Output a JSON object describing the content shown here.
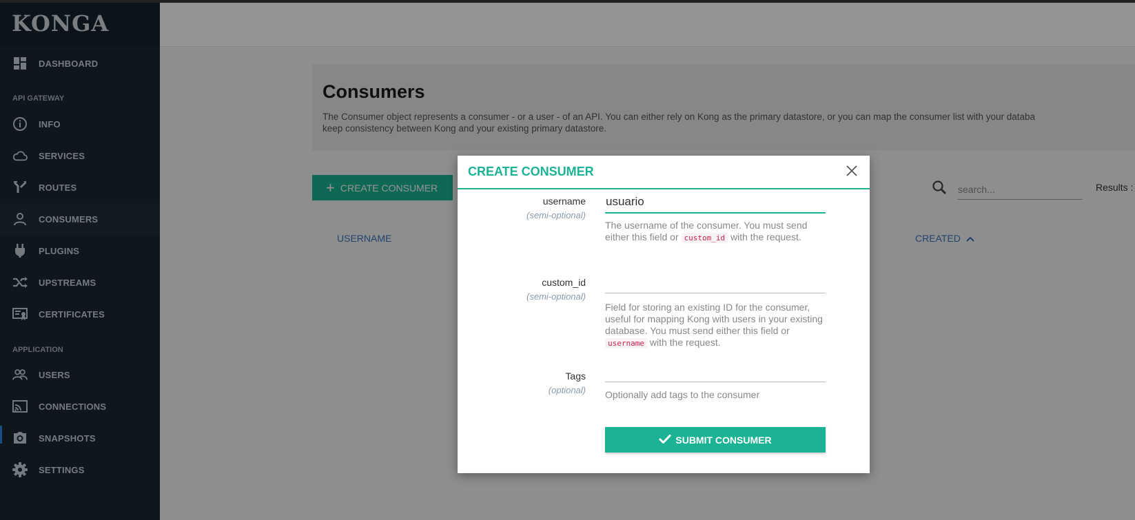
{
  "app": {
    "brand": "KONGA"
  },
  "sidebar": {
    "items": [
      {
        "label": "DASHBOARD",
        "icon": "dashboard-icon"
      },
      {
        "label": "INFO",
        "icon": "info-icon"
      },
      {
        "label": "SERVICES",
        "icon": "cloud-icon"
      },
      {
        "label": "ROUTES",
        "icon": "routes-icon"
      },
      {
        "label": "CONSUMERS",
        "icon": "user-icon"
      },
      {
        "label": "PLUGINS",
        "icon": "plug-icon"
      },
      {
        "label": "UPSTREAMS",
        "icon": "shuffle-icon"
      },
      {
        "label": "CERTIFICATES",
        "icon": "certificate-icon"
      },
      {
        "label": "USERS",
        "icon": "users-icon"
      },
      {
        "label": "CONNECTIONS",
        "icon": "cast-icon"
      },
      {
        "label": "SNAPSHOTS",
        "icon": "camera-icon"
      },
      {
        "label": "SETTINGS",
        "icon": "gear-icon"
      }
    ],
    "sections": {
      "api_gateway": "API GATEWAY",
      "application": "APPLICATION"
    },
    "active_item": "CONSUMERS"
  },
  "page": {
    "title": "Consumers",
    "description_line1": "The Consumer object represents a consumer - or a user - of an API. You can either rely on Kong as the primary datastore, or you can map the consumer list with your databa",
    "description_line2": "keep consistency between Kong and your existing primary datastore.",
    "create_button": "CREATE CONSUMER",
    "search_placeholder": "search...",
    "results_label": "Results :",
    "columns": {
      "username": "USERNAME",
      "created": "CREATED"
    }
  },
  "modal": {
    "title": "CREATE CONSUMER",
    "fields": {
      "username": {
        "label": "username",
        "sub": "(semi-optional)",
        "value": "usuario",
        "help_before": "The username of the consumer. You must send either this field or ",
        "help_code": "custom_id",
        "help_after": " with the request."
      },
      "custom_id": {
        "label": "custom_id",
        "sub": "(semi-optional)",
        "value": "",
        "help_before": "Field for storing an existing ID for the consumer, useful for mapping Kong with users in your existing database. You must send either this field or ",
        "help_code": "username",
        "help_after": " with the request."
      },
      "tags": {
        "label": "Tags",
        "sub": "(optional)",
        "value": "",
        "help": "Optionally add tags to the consumer"
      }
    },
    "submit_label": "SUBMIT CONSUMER"
  },
  "colors": {
    "accent": "#1bb394",
    "sidebar_bg": "#1b2731",
    "link": "#3a76b8"
  }
}
